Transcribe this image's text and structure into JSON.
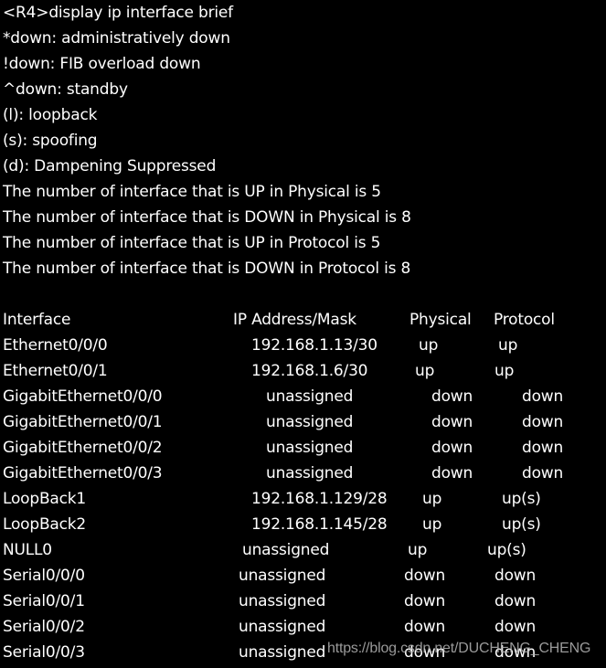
{
  "terminal": {
    "header_lines": [
      "<R4>display ip interface brief",
      "*down: administratively down",
      "!down: FIB overload down",
      "^down: standby",
      "(l): loopback",
      "(s): spoofing",
      "(d): Dampening Suppressed",
      "The number of interface that is UP in Physical is 5",
      "The number of interface that is DOWN in Physical is 8",
      "The number of interface that is UP in Protocol is 5",
      "The number of interface that is DOWN in Protocol is 8"
    ],
    "table": {
      "columns": [
        "Interface",
        "IP Address/Mask",
        "Physical",
        "Protocol"
      ],
      "rows": [
        [
          "Ethernet0/0/0",
          "192.168.1.13/30",
          "up",
          "up"
        ],
        [
          "Ethernet0/0/1",
          "192.168.1.6/30",
          "up",
          "up"
        ],
        [
          "GigabitEthernet0/0/0",
          "unassigned",
          "down",
          "down"
        ],
        [
          "GigabitEthernet0/0/1",
          "unassigned",
          "down",
          "down"
        ],
        [
          "GigabitEthernet0/0/2",
          "unassigned",
          "down",
          "down"
        ],
        [
          "GigabitEthernet0/0/3",
          "unassigned",
          "down",
          "down"
        ],
        [
          "LoopBack1",
          "192.168.1.129/28",
          "up",
          "up(s)"
        ],
        [
          "LoopBack2",
          "192.168.1.145/28",
          "up",
          "up(s)"
        ],
        [
          "NULL0",
          "unassigned",
          "up",
          "up(s)"
        ],
        [
          "Serial0/0/0",
          "unassigned",
          "down",
          "down"
        ],
        [
          "Serial0/0/1",
          "unassigned",
          "down",
          "down"
        ],
        [
          "Serial0/0/2",
          "unassigned",
          "down",
          "down"
        ],
        [
          "Serial0/0/3",
          "unassigned",
          "down",
          "down"
        ]
      ]
    }
  },
  "watermark": "https://blog.csdn.net/DUCHENG_CHENG",
  "colors": {
    "background": "#000000",
    "text": "#ffffff"
  }
}
